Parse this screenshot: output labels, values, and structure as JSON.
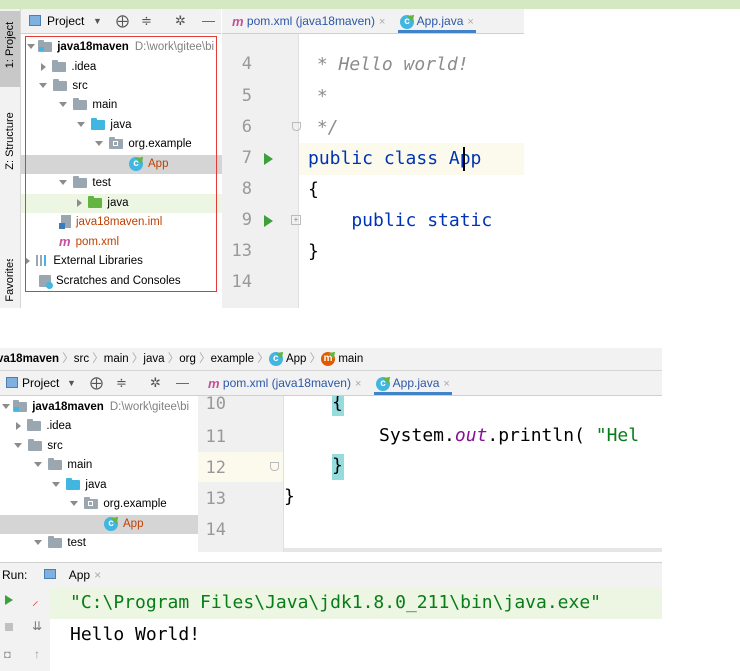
{
  "top": {
    "tool_windows": [
      "1: Project",
      "Z: Structure",
      "Favorites"
    ],
    "project_dropdown": "Project",
    "tabs": [
      {
        "label": "pom.xml (java18maven)",
        "active": false
      },
      {
        "label": "App.java",
        "active": true
      }
    ],
    "tree": [
      {
        "label": "java18maven",
        "path": "D:\\work\\gitee\\bi",
        "indent": 0,
        "expanded": true,
        "icon": "project-folder-icon"
      },
      {
        "label": ".idea",
        "indent": 1,
        "expanded": false,
        "icon": "folder-icon"
      },
      {
        "label": "src",
        "indent": 1,
        "expanded": true,
        "icon": "folder-icon"
      },
      {
        "label": "main",
        "indent": 2,
        "expanded": true,
        "icon": "folder-icon"
      },
      {
        "label": "java",
        "indent": 3,
        "expanded": true,
        "icon": "source-folder-icon"
      },
      {
        "label": "org.example",
        "indent": 4,
        "expanded": true,
        "icon": "package-icon"
      },
      {
        "label": "App",
        "indent": 5,
        "leaf": true,
        "icon": "class-icon",
        "selected": true
      },
      {
        "label": "test",
        "indent": 2,
        "expanded": true,
        "icon": "folder-icon"
      },
      {
        "label": "java",
        "indent": 3,
        "expanded": false,
        "icon": "test-folder-icon"
      },
      {
        "label": "java18maven.iml",
        "indent": 2,
        "leaf": true,
        "icon": "iml-file-icon"
      },
      {
        "label": "pom.xml",
        "indent": 2,
        "leaf": true,
        "icon": "maven-icon"
      },
      {
        "label": "External Libraries",
        "indent": 0,
        "expanded": false,
        "icon": "libraries-icon"
      },
      {
        "label": "Scratches and Consoles",
        "indent": 0,
        "leaf": true,
        "icon": "scratches-icon"
      }
    ],
    "editor_lines": [
      {
        "num": "4",
        "text": " * Hello world!"
      },
      {
        "num": "5",
        "text": " *"
      },
      {
        "num": "6",
        "text": " */"
      },
      {
        "num": "7",
        "text": "public class App"
      },
      {
        "num": "8",
        "text": "{"
      },
      {
        "num": "9",
        "text": "    public static"
      },
      {
        "num": "13",
        "text": "}"
      },
      {
        "num": "14",
        "text": ""
      }
    ],
    "highlight_color": "#e53935"
  },
  "bottom": {
    "breadcrumb": [
      "va18maven",
      "src",
      "main",
      "java",
      "org",
      "example",
      "App",
      "main"
    ],
    "project_dropdown": "Project",
    "tabs": [
      {
        "label": "pom.xml (java18maven)",
        "active": false
      },
      {
        "label": "App.java",
        "active": true
      }
    ],
    "tree": [
      {
        "label": "java18maven",
        "path": "D:\\work\\gitee\\bi",
        "indent": 0,
        "expanded": true
      },
      {
        "label": ".idea",
        "indent": 1,
        "expanded": false
      },
      {
        "label": "src",
        "indent": 1,
        "expanded": true
      },
      {
        "label": "main",
        "indent": 2,
        "expanded": true
      },
      {
        "label": "java",
        "indent": 3,
        "expanded": true
      },
      {
        "label": "org.example",
        "indent": 4,
        "expanded": true
      },
      {
        "label": "App",
        "indent": 5,
        "selected": true
      },
      {
        "label": "test",
        "indent": 2,
        "expanded": true
      }
    ],
    "editor_lines": [
      {
        "num": "10",
        "text": "{"
      },
      {
        "num": "11",
        "text": "System.out.println( \"Hel"
      },
      {
        "num": "12",
        "text": "}"
      },
      {
        "num": "13",
        "text": "}"
      },
      {
        "num": "14",
        "text": ""
      }
    ],
    "run": {
      "label": "Run:",
      "tab": "App",
      "lines": [
        "\"C:\\Program Files\\Java\\jdk1.8.0_211\\bin\\java.exe\"",
        "Hello World!"
      ]
    }
  }
}
